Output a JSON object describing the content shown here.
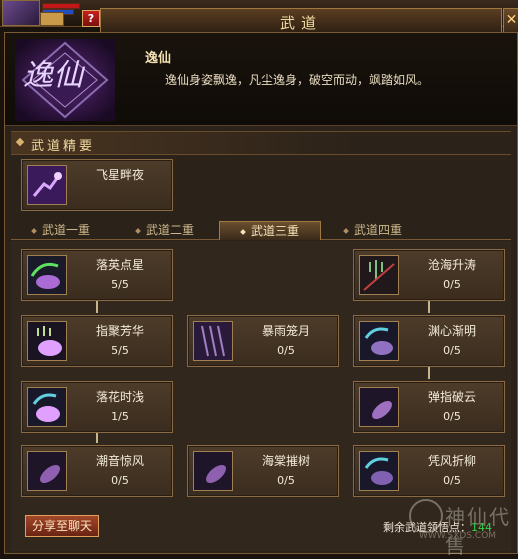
{
  "window": {
    "title": "武道"
  },
  "header": {
    "skill_name": "逸仙",
    "description": "逸仙身姿飘逸，凡尘逸身，破空而动，飒踏如风。",
    "emblem_text": "逸仙"
  },
  "essentials": {
    "label": "武道精要",
    "card": {
      "name": "飞星畔夜",
      "icon": "purple-sigil-icon"
    }
  },
  "tabs": [
    "武道一重",
    "武道二重",
    "武道三重",
    "武道四重"
  ],
  "active_tab": "武道三重",
  "skills": [
    {
      "name": "落英点星",
      "points": "5/5",
      "icon": "green-swirl-icon"
    },
    {
      "name": "沧海升涛",
      "points": "0/5",
      "icon": "trident-sigil-icon"
    },
    {
      "name": "指聚芳华",
      "points": "5/5",
      "icon": "trident-sigil-icon"
    },
    {
      "name": "暴雨笼月",
      "points": "0/5",
      "icon": "purple-rain-icon"
    },
    {
      "name": "渊心渐明",
      "points": "0/5",
      "icon": "cyan-swirl-icon"
    },
    {
      "name": "落花时浅",
      "points": "1/5",
      "icon": "cyan-swirl-icon"
    },
    {
      "name": "弹指破云",
      "points": "0/5",
      "icon": "purple-feather-icon"
    },
    {
      "name": "潮音惊风",
      "points": "0/5",
      "icon": "purple-feather-icon"
    },
    {
      "name": "海棠摧树",
      "points": "0/5",
      "icon": "purple-feather-icon"
    },
    {
      "name": "凭风折柳",
      "points": "0/5",
      "icon": "cyan-swirl-icon"
    }
  ],
  "share_button": "分享至聊天",
  "remaining": {
    "label": "剩余武道领悟点：",
    "value": "144"
  },
  "watermark": {
    "text": "神仙代售",
    "url": "WWW.SXDS.COM"
  },
  "colors": {
    "accent": "#d8b070",
    "active_points": "#36d24a",
    "share_button": "#8a3018"
  }
}
